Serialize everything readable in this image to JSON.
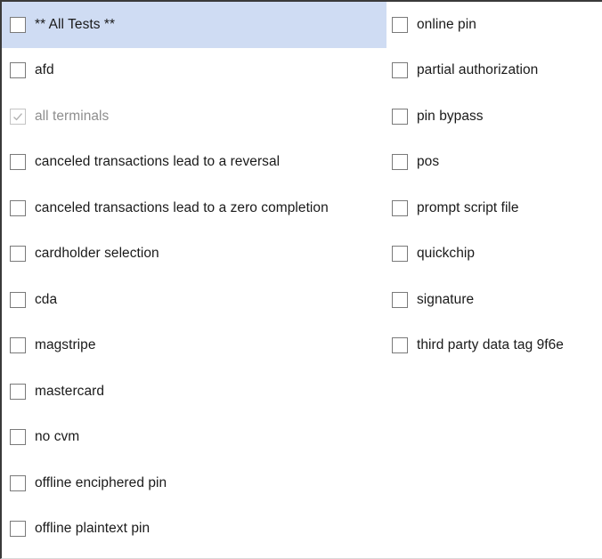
{
  "checklist": {
    "left": [
      {
        "label": "** All Tests **",
        "checked": false,
        "disabled": false,
        "highlighted": true
      },
      {
        "label": "afd",
        "checked": false,
        "disabled": false
      },
      {
        "label": "all terminals",
        "checked": true,
        "disabled": true
      },
      {
        "label": "canceled transactions lead to a reversal",
        "checked": false,
        "disabled": false
      },
      {
        "label": "canceled transactions lead to a zero completion",
        "checked": false,
        "disabled": false
      },
      {
        "label": "cardholder selection",
        "checked": false,
        "disabled": false
      },
      {
        "label": "cda",
        "checked": false,
        "disabled": false
      },
      {
        "label": "magstripe",
        "checked": false,
        "disabled": false
      },
      {
        "label": "mastercard",
        "checked": false,
        "disabled": false
      },
      {
        "label": "no cvm",
        "checked": false,
        "disabled": false
      },
      {
        "label": "offline enciphered pin",
        "checked": false,
        "disabled": false
      },
      {
        "label": "offline plaintext pin",
        "checked": false,
        "disabled": false
      }
    ],
    "right": [
      {
        "label": "online pin",
        "checked": false,
        "disabled": false
      },
      {
        "label": "partial authorization",
        "checked": false,
        "disabled": false
      },
      {
        "label": "pin bypass",
        "checked": false,
        "disabled": false
      },
      {
        "label": "pos",
        "checked": false,
        "disabled": false
      },
      {
        "label": "prompt script file",
        "checked": false,
        "disabled": false
      },
      {
        "label": "quickchip",
        "checked": false,
        "disabled": false
      },
      {
        "label": "signature",
        "checked": false,
        "disabled": false
      },
      {
        "label": "third party data tag 9f6e",
        "checked": false,
        "disabled": false
      }
    ]
  }
}
